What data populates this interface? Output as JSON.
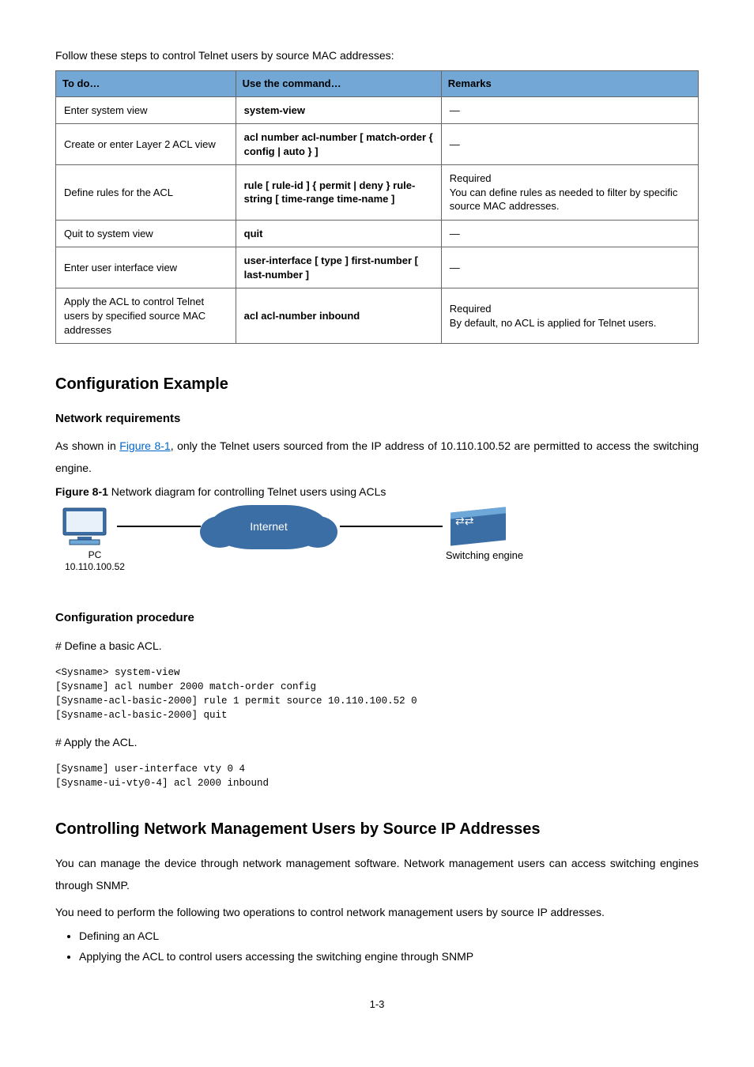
{
  "intro": "Follow these steps to control Telnet users by source MAC addresses:",
  "table": {
    "headers": [
      "To do…",
      "Use the command…",
      "Remarks"
    ],
    "rows": [
      {
        "to": "Enter system view",
        "cmd": "system-view",
        "rem": "—"
      },
      {
        "to": "Create or enter Layer 2 ACL view",
        "cmd": "acl number acl-number [ match-order { config | auto } ]",
        "rem": "—"
      },
      {
        "to": "Define rules for the ACL",
        "cmd": "rule [ rule-id ] { permit | deny } rule-string [ time-range time-name ]",
        "rem": "Required\nYou can define rules as needed to filter by specific source MAC addresses."
      },
      {
        "to": "Quit to system view",
        "cmd": "quit",
        "rem": "—"
      },
      {
        "to": "Enter user interface view",
        "cmd": "user-interface [ type ] first-number [ last-number ]",
        "rem": "—"
      },
      {
        "to": "Apply the ACL to control Telnet users by specified source MAC addresses",
        "cmd": "acl acl-number inbound",
        "rem": "Required\nBy default, no ACL is applied for Telnet users."
      }
    ]
  },
  "example": {
    "title": "Configuration Example",
    "net_req_title": "Network requirements",
    "net_req_pre": "As shown in ",
    "net_req_link": "Figure 8-1",
    "net_req_post": ", only the Telnet users sourced from the IP address of 10.110.100.52 are permitted to access the switching engine.",
    "fig_caption_label": "Figure 8-1",
    "fig_caption_text": "Network diagram for controlling Telnet users using ACLs",
    "pc_label_top": "PC",
    "pc_label_bottom": "10.110.100.52",
    "internet_label": "Internet",
    "switch_label": "Switching engine",
    "proc_title": "Configuration procedure",
    "step1_label": "# Define a basic ACL.",
    "step1_lines": [
      "<Sysname> system-view",
      "[Sysname] acl number 2000 match-order config",
      "[Sysname-acl-basic-2000] rule 1 permit source 10.110.100.52 0",
      "[Sysname-acl-basic-2000] quit"
    ],
    "step2_label": "# Apply the ACL.",
    "step2_lines": [
      "[Sysname] user-interface vty 0 4",
      "[Sysname-ui-vty0-4] acl 2000 inbound"
    ]
  },
  "snmp": {
    "title": "Controlling Network Management Users by Source IP Addresses",
    "p1": "You can manage the device through network management software. Network management users can access switching engines through SNMP.",
    "p2": "You need to perform the following two operations to control network management users by source IP addresses.",
    "bullets": [
      "Defining an ACL",
      "Applying the ACL to control users accessing the switching engine through SNMP"
    ]
  },
  "pagenum": "1-3"
}
